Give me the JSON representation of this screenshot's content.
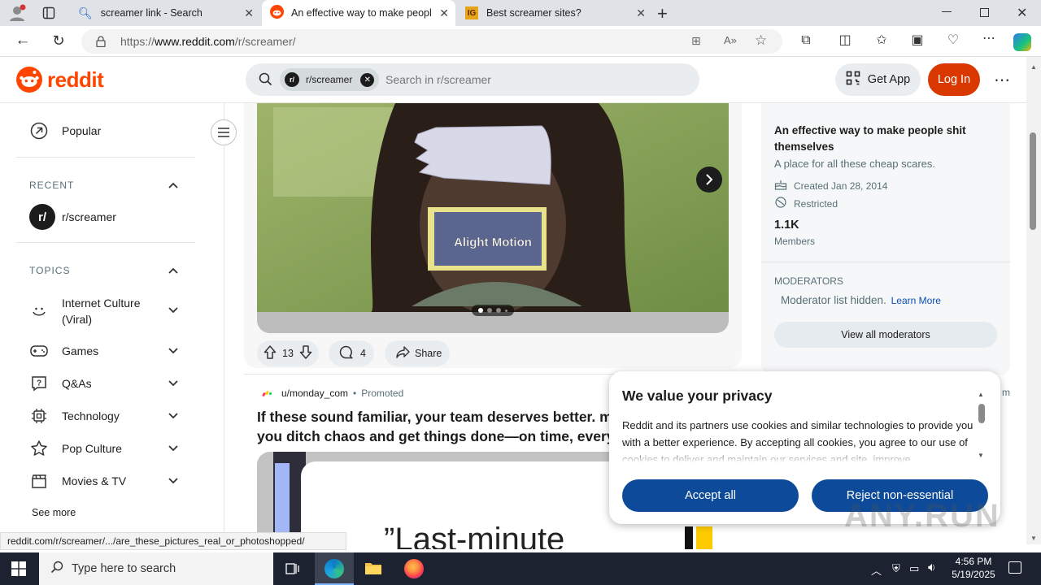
{
  "browser": {
    "tabs": [
      {
        "title": "screamer link - Search"
      },
      {
        "title": "An effective way to make people shit themselves"
      },
      {
        "title": "Best screamer sites?"
      }
    ],
    "url_prefix": "https://",
    "url_host": "www.reddit.com",
    "url_path": "/r/screamer/"
  },
  "reddit_header": {
    "logo_text": "reddit",
    "chip_label": "r/screamer",
    "search_placeholder": "Search in r/screamer",
    "get_app_label": "Get App",
    "login_label": "Log In",
    "accent": "#d93900"
  },
  "sidebar": {
    "popular_label": "Popular",
    "recent_heading": "RECENT",
    "recent_items": [
      {
        "label": "r/screamer"
      }
    ],
    "topics_heading": "TOPICS",
    "topics": [
      {
        "label": "Internet Culture (Viral)",
        "icon": "smile-icon"
      },
      {
        "label": "Games",
        "icon": "gamepad-icon"
      },
      {
        "label": "Q&As",
        "icon": "question-icon"
      },
      {
        "label": "Technology",
        "icon": "chip-icon"
      },
      {
        "label": "Pop Culture",
        "icon": "star-icon"
      },
      {
        "label": "Movies & TV",
        "icon": "clapperboard-icon"
      }
    ],
    "see_more_label": "See more"
  },
  "post": {
    "watermark": "Alight Motion",
    "upvotes": "13",
    "comments": "4",
    "share_label": "Share"
  },
  "promoted_post": {
    "author": "u/monday_com",
    "promoted_label": "Promoted",
    "title": "If these sound familiar, your team deserves better. m",
    "title_line2": "you ditch chaos and get things done—on time, every",
    "image_text": "”Last-minute"
  },
  "community": {
    "title": "An effective way to make people shit themselves",
    "description": "A place for all these cheap scares.",
    "created": "Created Jan 28, 2014",
    "restriction": "Restricted",
    "members_count": "1.1K",
    "members_label": "Members",
    "moderators_heading": "MODERATORS",
    "moderators_hidden": "Moderator list hidden.",
    "learn_more": "Learn More",
    "view_all_mods": "View all moderators",
    "clipped_text": "m"
  },
  "privacy_modal": {
    "title": "We value your privacy",
    "body": "Reddit and its partners use cookies and similar technologies to provide you with a better experience. By accepting all cookies, you agree to our use of cookies to deliver and maintain our services and site, improve",
    "accept_label": "Accept all",
    "reject_label": "Reject non-essential",
    "button_color": "#0d4a9a"
  },
  "status_bar": {
    "link": "reddit.com/r/screamer/.../are_these_pictures_real_or_photoshopped/"
  },
  "watermark": {
    "text": "ANY.RUN"
  },
  "taskbar": {
    "search_placeholder": "Type here to search",
    "time": "4:56 PM",
    "date": "5/19/2025"
  }
}
